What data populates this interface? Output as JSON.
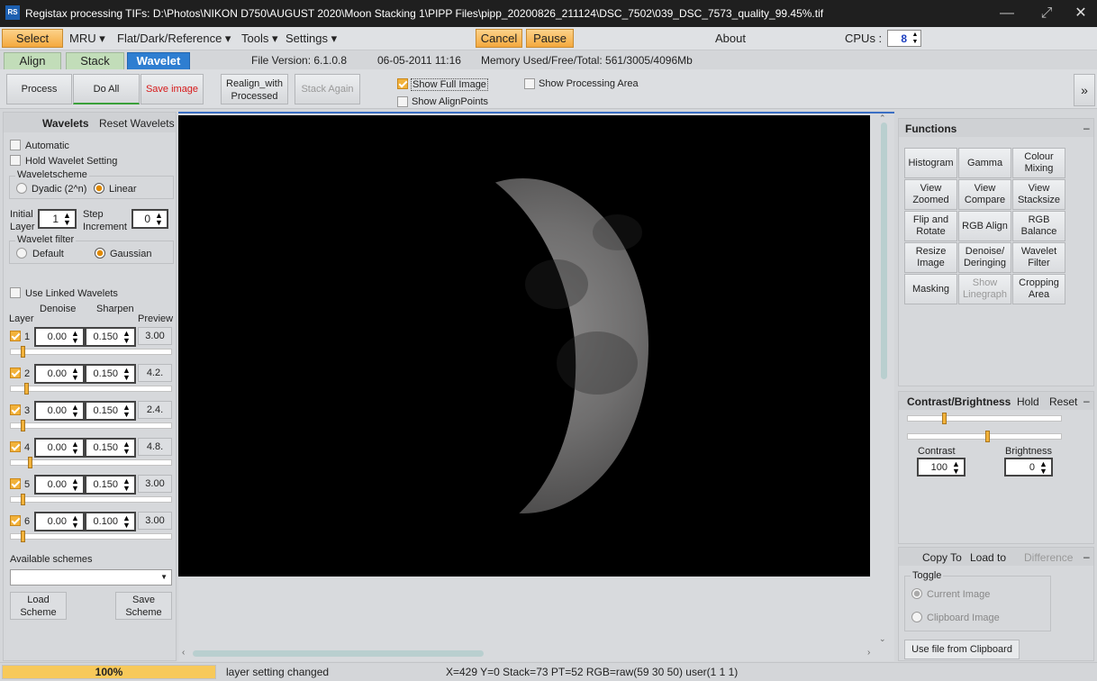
{
  "app": {
    "icon_label": "RS",
    "title": "Registax processing TIFs: D:\\Photos\\NIKON D750\\AUGUST 2020\\Moon Stacking 1\\PIPP Files\\pipp_20200826_211124\\DSC_7502\\039_DSC_7573_quality_99.45%.tif"
  },
  "window": {
    "minimize": "—",
    "maximize": "⤢",
    "close": "✕"
  },
  "menu": {
    "select": "Select",
    "mru": "MRU ▾",
    "flat": "Flat/Dark/Reference ▾",
    "tools": "Tools ▾",
    "settings": "Settings ▾",
    "cancel": "Cancel",
    "pause": "Pause",
    "about": "About",
    "cpus_label": "CPUs :",
    "cpus_value": "8"
  },
  "tabs": {
    "align": "Align",
    "stack": "Stack",
    "wavelet": "Wavelet"
  },
  "info": {
    "file_version": "File Version: 6.1.0.8",
    "date": "06-05-2011 11:16",
    "memory": "Memory Used/Free/Total: 561/3005/4096Mb"
  },
  "toolbar": {
    "process": "Process",
    "do_all": "Do All",
    "save_image": "Save image",
    "realign": "Realign_with Processed",
    "stack_again": "Stack Again",
    "show_full_image": "Show Full Image",
    "show_alignpoints": "Show AlignPoints",
    "show_processing_area": "Show Processing Area",
    "expand": "»"
  },
  "wavelets": {
    "title": "Wavelets",
    "reset": "Reset Wavelets",
    "automatic": "Automatic",
    "hold": "Hold Wavelet Setting",
    "scheme_label": "Waveletscheme",
    "dyadic": "Dyadic (2^n)",
    "linear": "Linear",
    "initial_layer": "Initial Layer",
    "initial_value": "1",
    "step_increment": "Step Increment",
    "step_value": "0",
    "filter_label": "Wavelet filter",
    "default": "Default",
    "gaussian": "Gaussian",
    "use_linked": "Use Linked Wavelets",
    "col_layer": "Layer",
    "col_denoise": "Denoise",
    "col_sharpen": "Sharpen",
    "col_preview": "Preview",
    "layers": [
      {
        "n": "1",
        "denoise": "0.00",
        "sharpen": "0.150",
        "preview": "3.00",
        "level": 0.08
      },
      {
        "n": "2",
        "denoise": "0.00",
        "sharpen": "0.150",
        "preview": "4.2.",
        "level": 0.1
      },
      {
        "n": "3",
        "denoise": "0.00",
        "sharpen": "0.150",
        "preview": "2.4.",
        "level": 0.08
      },
      {
        "n": "4",
        "denoise": "0.00",
        "sharpen": "0.150",
        "preview": "4.8.",
        "level": 0.12
      },
      {
        "n": "5",
        "denoise": "0.00",
        "sharpen": "0.150",
        "preview": "3.00",
        "level": 0.08
      },
      {
        "n": "6",
        "denoise": "0.00",
        "sharpen": "0.100",
        "preview": "3.00",
        "level": 0.08
      }
    ],
    "available_schemes": "Available schemes",
    "load_scheme": "Load Scheme",
    "save_scheme": "Save Scheme"
  },
  "functions": {
    "title": "Functions",
    "buttons": [
      "Histogram",
      "Gamma",
      "Colour Mixing",
      "View Zoomed",
      "View Compare",
      "View Stacksize",
      "Flip and Rotate",
      "RGB Align",
      "RGB Balance",
      "Resize Image",
      "Denoise/ Deringing",
      "Wavelet Filter",
      "Masking",
      "Show Linegraph",
      "Cropping Area"
    ]
  },
  "contrast": {
    "title": "Contrast/Brightness",
    "hold": "Hold",
    "reset": "Reset",
    "contrast_label": "Contrast",
    "contrast_value": "100",
    "brightness_label": "Brightness",
    "brightness_value": "0",
    "contrast_level": 0.22,
    "brightness_level": 0.5
  },
  "clipboard": {
    "copy_to": "Copy To",
    "load_to": "Load to",
    "difference": "Difference",
    "toggle": "Toggle",
    "current_image": "Current Image",
    "clipboard_image": "Clipboard Image",
    "use_file": "Use file from Clipboard"
  },
  "status": {
    "progress": "100%",
    "message": "layer setting changed",
    "readout": "X=429 Y=0 Stack=73 PT=52 RGB=raw(59 30 50) user(1 1 1)"
  },
  "colors": {
    "accent_orange": "#f4a93e",
    "tab_blue": "#2e7ed1",
    "tab_green": "#c2ddb9",
    "status_yellow": "#f7c95a"
  }
}
